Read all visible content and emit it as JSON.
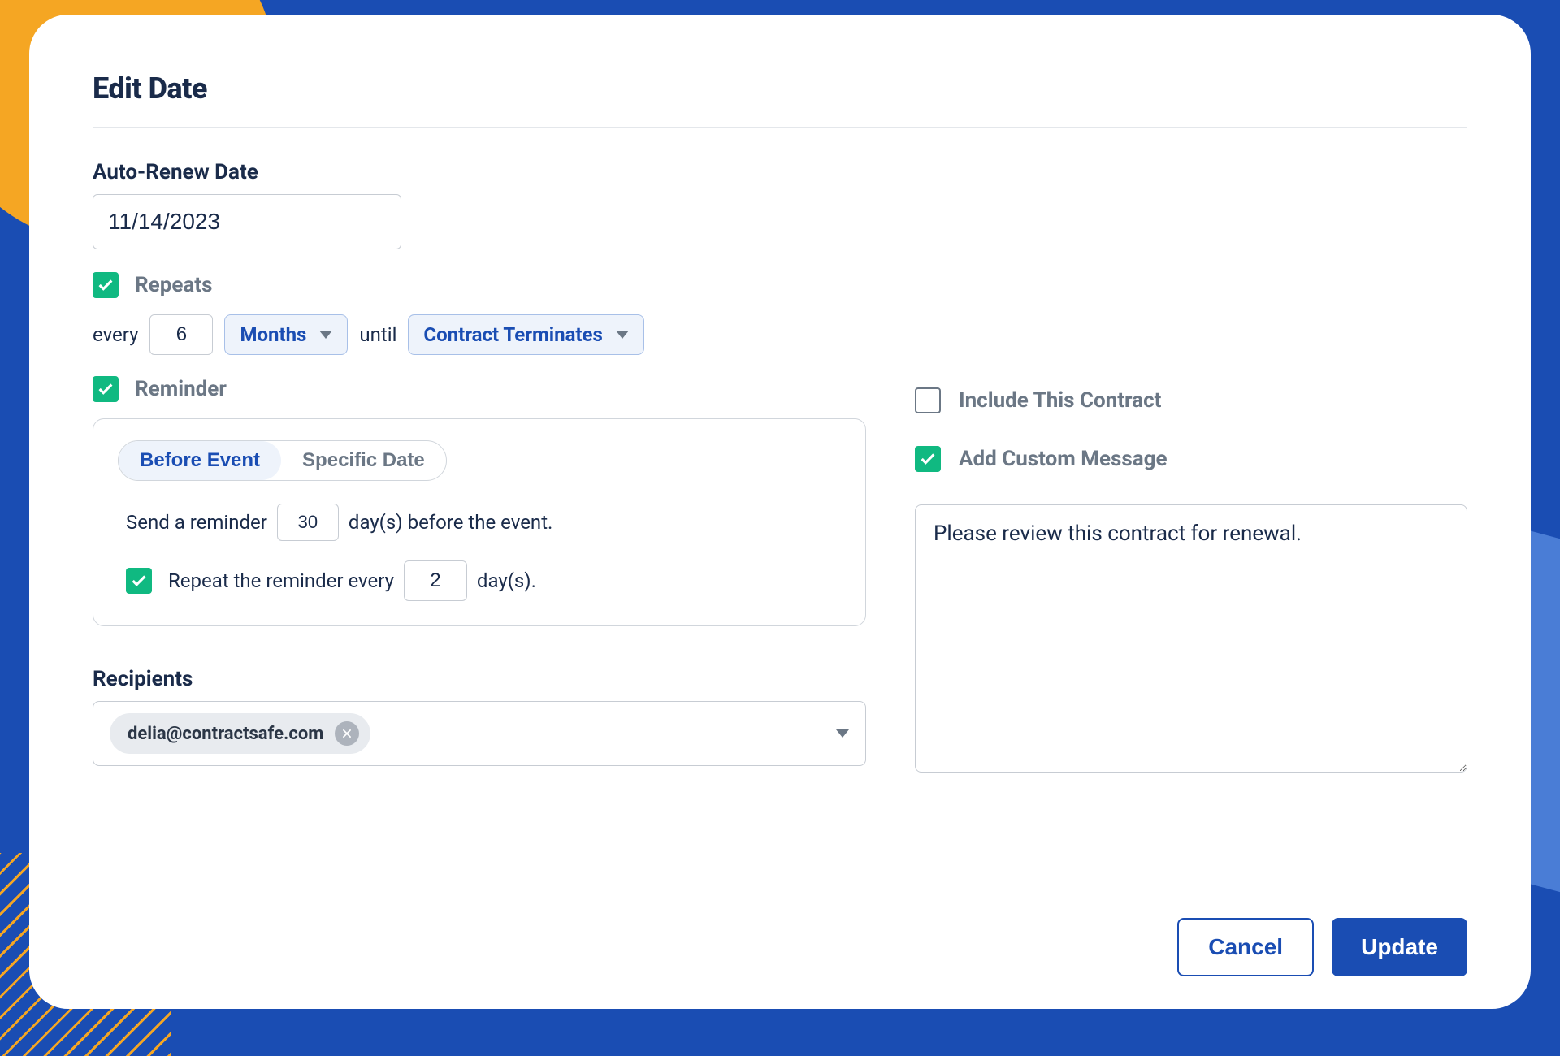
{
  "title": "Edit Date",
  "autoRenew": {
    "label": "Auto-Renew Date",
    "value": "11/14/2023"
  },
  "repeats": {
    "checked": true,
    "label": "Repeats",
    "everyLabel": "every",
    "everyValue": "6",
    "unit": "Months",
    "untilLabel": "until",
    "untilValue": "Contract Terminates"
  },
  "reminder": {
    "checked": true,
    "label": "Reminder",
    "tabs": {
      "before": "Before Event",
      "specific": "Specific Date"
    },
    "sendPrefix": "Send a reminder",
    "daysBefore": "30",
    "sendSuffix": "day(s) before the event.",
    "repeatChecked": true,
    "repeatPrefix": "Repeat the reminder every",
    "repeatValue": "2",
    "repeatSuffix": "day(s)."
  },
  "recipients": {
    "label": "Recipients",
    "chips": [
      "delia@contractsafe.com"
    ]
  },
  "includeContract": {
    "checked": false,
    "label": "Include This Contract"
  },
  "customMessage": {
    "checked": true,
    "label": "Add Custom Message",
    "value": "Please review this contract for renewal."
  },
  "buttons": {
    "cancel": "Cancel",
    "update": "Update"
  }
}
